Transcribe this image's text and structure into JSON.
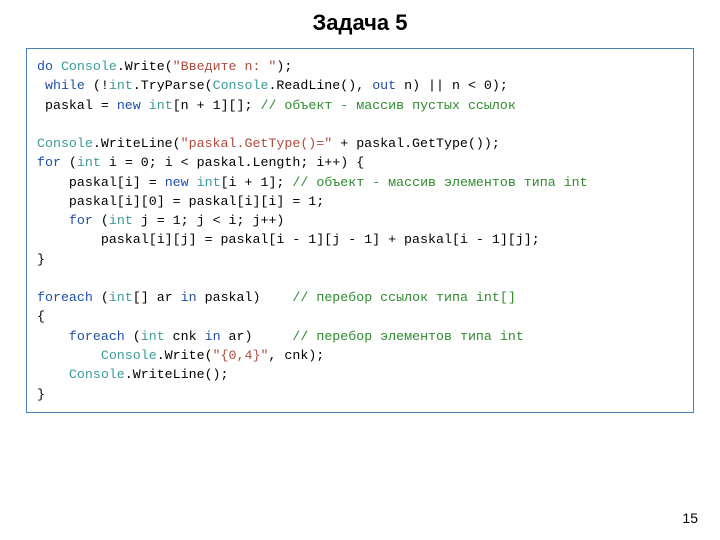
{
  "title": "Задача 5",
  "page_number": "15",
  "code": {
    "l1": {
      "kw1": "do",
      "typ1": "Console",
      "t1": ".Write(",
      "str1": "\"Введите n: \"",
      "t2": ");"
    },
    "l2": {
      "pad": " ",
      "kw1": "while",
      "t1": " (!",
      "typ1": "int",
      "t2": ".TryParse(",
      "typ2": "Console",
      "t3": ".ReadLine(), ",
      "kw2": "out",
      "t4": " n) || n < 0);"
    },
    "l3": {
      "pad": " ",
      "t1": "paskal = ",
      "kw1": "new",
      "t2": " ",
      "typ1": "int",
      "t3": "[n + 1][]; ",
      "cmt": "// объект - массив пустых ссылок"
    },
    "l4": "",
    "l5": {
      "typ1": "Console",
      "t1": ".WriteLine(",
      "str1": "\"paskal.GetType()=\"",
      "t2": " + paskal.GetType());"
    },
    "l6": {
      "kw1": "for",
      "t1": " (",
      "typ1": "int",
      "t2": " i = 0; i < paskal.Length; i++) {"
    },
    "l7": {
      "pad": "    ",
      "t1": "paskal[i] = ",
      "kw1": "new",
      "t2": " ",
      "typ1": "int",
      "t3": "[i + 1]; ",
      "cmt": "// объект - массив элементов типа int"
    },
    "l8": {
      "pad": "    ",
      "t1": "paskal[i][0] = paskal[i][i] = 1;"
    },
    "l9": {
      "pad": "    ",
      "kw1": "for",
      "t1": " (",
      "typ1": "int",
      "t2": " j = 1; j < i; j++)"
    },
    "l10": {
      "pad": "        ",
      "t1": "paskal[i][j] = paskal[i - 1][j - 1] + paskal[i - 1][j];"
    },
    "l11": {
      "t1": "}"
    },
    "l12": "",
    "l13": {
      "kw1": "foreach",
      "t1": " (",
      "typ1": "int",
      "t2": "[] ar ",
      "kw2": "in",
      "t3": " paskal)    ",
      "cmt": "// перебор ссылок типа int[]"
    },
    "l14": {
      "t1": "{"
    },
    "l15": {
      "pad": "    ",
      "kw1": "foreach",
      "t1": " (",
      "typ1": "int",
      "t2": " cnk ",
      "kw2": "in",
      "t3": " ar)     ",
      "cmt": "// перебор элементов типа int"
    },
    "l16": {
      "pad": "        ",
      "typ1": "Console",
      "t1": ".Write(",
      "str1": "\"{0,4}\"",
      "t2": ", cnk);"
    },
    "l17": {
      "pad": "    ",
      "typ1": "Console",
      "t1": ".WriteLine();"
    },
    "l18": {
      "t1": "}"
    }
  }
}
